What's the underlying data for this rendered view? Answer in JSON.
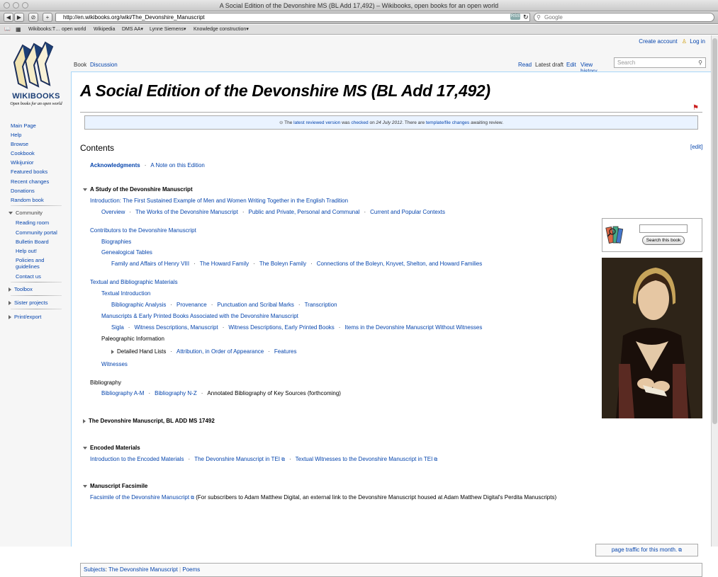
{
  "browser": {
    "window_title": "A Social Edition of the Devonshire MS (BL Add 17,492) – Wikibooks, open books for an open world",
    "url": "http://en.wikibooks.org/wiki/The_Devonshire_Manuscript",
    "rss_label": "RSS",
    "search_placeholder": "Google",
    "bookmarks": [
      "Wikibooks:T… open world",
      "Wikipedia",
      "DMS AA▾",
      "Lynne Siemens▾",
      "Knowledge construction▾"
    ]
  },
  "logo": {
    "name": "WIKIBOOKS",
    "tagline": "Open books for an open world"
  },
  "personal": {
    "create_account": "Create account",
    "log_in": "Log in"
  },
  "tabs": {
    "book": "Book",
    "discussion": "Discussion",
    "read": "Read",
    "latest_draft": "Latest draft",
    "edit": "Edit",
    "view_history": "View history",
    "search_placeholder": "Search"
  },
  "nav": {
    "main": [
      "Main Page",
      "Help",
      "Browse",
      "Cookbook",
      "Wikijunior",
      "Featured books",
      "Recent changes",
      "Donations",
      "Random book"
    ],
    "community_heading": "Community",
    "community": [
      "Reading room",
      "Community portal",
      "Bulletin Board",
      "Help out!",
      "Policies and guidelines",
      "Contact us"
    ],
    "toolbox": "Toolbox",
    "sister": "Sister projects",
    "print": "Print/export"
  },
  "page": {
    "title": "A Social Edition of the Devonshire MS (BL Add 17,492)",
    "review": {
      "pre": "The ",
      "link1": "latest reviewed version",
      "mid1": " was ",
      "link2": "checked",
      "mid2": " on ",
      "date": "24 July 2012",
      "mid3": ". There are ",
      "link3": "template/file changes",
      "post": " awaiting review."
    },
    "contents_heading": "Contents",
    "edit_label": "[edit]",
    "ack": "Acknowledgments",
    "note": "A Note on this Edition",
    "study_heading": "A Study of the Devonshire Manuscript",
    "intro": "Introduction: The First Sustained Example of Men and Women Writing Together in the English Tradition",
    "intro_subs": [
      "Overview",
      "The Works of the Devonshire Manuscript",
      "Public and Private, Personal and Communal",
      "Current and Popular Contexts"
    ],
    "contributors": "Contributors to the Devonshire Manuscript",
    "biographies": "Biographies",
    "genealogical": "Genealogical Tables",
    "gen_subs": [
      "Family and Affairs of Henry VIII",
      "The Howard Family",
      "The Boleyn Family",
      "Connections of the Boleyn, Knyvet, Shelton, and Howard Families"
    ],
    "textual": "Textual and Bibliographic Materials",
    "textual_intro": "Textual Introduction",
    "textual_subs": [
      "Bibliographic Analysis",
      "Provenance",
      "Punctuation and Scribal Marks",
      "Transcription"
    ],
    "manuscripts": "Manuscripts & Early Printed Books Associated with the Devonshire Manuscript",
    "ms_subs": [
      "Sigla",
      "Witness Descriptions, Manuscript",
      "Witness Descriptions, Early Printed Books",
      "Items in the Devonshire Manuscript Without Witnesses"
    ],
    "paleographic": "Paleographic Information",
    "detailed": "Detailed Hand Lists",
    "paleo_subs": [
      "Attribution, in Order of Appearance",
      "Features"
    ],
    "witnesses": "Witnesses",
    "bibliography": "Bibliography",
    "bib_subs": [
      "Bibliography A-M",
      "Bibliography N-Z"
    ],
    "bib_annot": "Annotated Bibliography of Key Sources (forthcoming)",
    "devonshire_ms": "The Devonshire Manuscript, BL ADD MS 17492",
    "encoded_heading": "Encoded Materials",
    "encoded_subs": [
      "Introduction to the Encoded Materials",
      "The Devonshire Manuscript in TEI",
      "Textual Witnesses to the Devonshire Manuscript in TEI"
    ],
    "facsimile_heading": "Manuscript Facsimile",
    "facsimile_link": "Facsimile of the Devonshire Manuscript",
    "facsimile_text": " (For subscribers to Adam Matthew Digital, an external link to the Devonshire Manuscript housed at Adam Matthew Digital's Perdita Manuscripts)",
    "search_book_button": "Search this book",
    "traffic": "page traffic for this month.",
    "subjects_label": "Subjects",
    "subjects": [
      "The Devonshire Manuscript",
      "Poems"
    ]
  }
}
